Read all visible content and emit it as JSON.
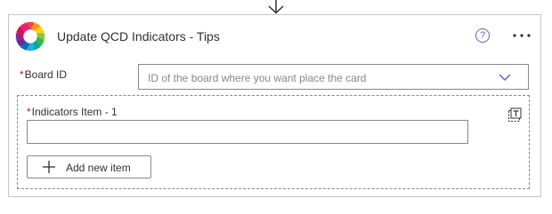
{
  "action": {
    "title": "Update QCD Indicators - Tips",
    "help_icon_glyph": "?",
    "more_icon": "more-options-icon",
    "logo_icon": "app-logo-icon"
  },
  "fields": {
    "board_id": {
      "required_mark": "*",
      "label": "Board ID",
      "placeholder": "ID of the board where you want place the card"
    },
    "indicators": {
      "required_mark": "*",
      "label": "Indicators Item - 1",
      "value": "",
      "switch_icon": "switch-to-text-mode-icon",
      "add_button_label": "Add new item"
    }
  },
  "colors": {
    "accent": "#5c5fc4",
    "required": "#a4262c",
    "border": "#8a8886"
  }
}
